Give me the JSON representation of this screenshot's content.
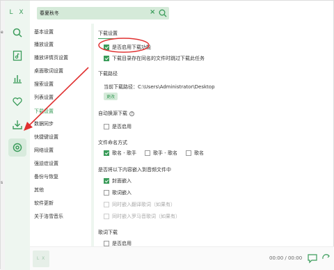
{
  "app": {
    "logo": "L X"
  },
  "left_edge": {
    "top_char": "e",
    "mid_char": "s"
  },
  "search": {
    "value": "春夏秋冬",
    "clear_icon": "close-icon",
    "search_icon": "search-icon"
  },
  "sidebar": {
    "items": [
      {
        "icon": "search-icon"
      },
      {
        "icon": "music-list-icon"
      },
      {
        "icon": "chart-icon"
      },
      {
        "icon": "heart-icon"
      },
      {
        "icon": "download-icon"
      },
      {
        "icon": "settings-icon",
        "active": true
      }
    ]
  },
  "nav": {
    "items": [
      {
        "label": "基本设置"
      },
      {
        "label": "播放设置"
      },
      {
        "label": "播放详情页设置"
      },
      {
        "label": "桌面歌词设置"
      },
      {
        "label": "搜索设置"
      },
      {
        "label": "列表设置"
      },
      {
        "label": "下载设置",
        "active": true
      },
      {
        "label": "数据同步"
      },
      {
        "label": "快捷键设置"
      },
      {
        "label": "网络设置"
      },
      {
        "label": "强迫症设置"
      },
      {
        "label": "备份与恢复"
      },
      {
        "label": "其他"
      },
      {
        "label": "软件更新"
      },
      {
        "label": "关于洛雪音乐"
      }
    ]
  },
  "download": {
    "section_title": "下载设置",
    "enable_label": "是否启用下载功能",
    "skip_label": "下载目录存在同名的文件时跳过下载此任务",
    "path_title": "下载路径",
    "path_label": "当前下载路径：C:\\Users\\Administrator\\Desktop",
    "change_button": "更改",
    "lyric_title": "自动换源下载",
    "lyric_option": "是否启用",
    "naming_title": "文件命名方式",
    "naming_options": [
      "歌名 - 歌手",
      "歌手 - 歌名",
      "歌名"
    ],
    "embed_title": "是否将以下内容嵌入到音频文件中",
    "embed_options": [
      "封面嵌入",
      "歌词嵌入",
      "同时嵌入翻译歌词（如果有）",
      "同时嵌入罗马音歌词（如果有）"
    ],
    "lyric_download_title": "歌词下载",
    "lyric_download_option": "是否启用"
  },
  "player": {
    "logo": "L X",
    "time": "00:00 / 00:00"
  },
  "colors": {
    "accent": "#3a9c5a",
    "sidebar_bg": "#eef6f0",
    "annotation": "#e03030"
  }
}
